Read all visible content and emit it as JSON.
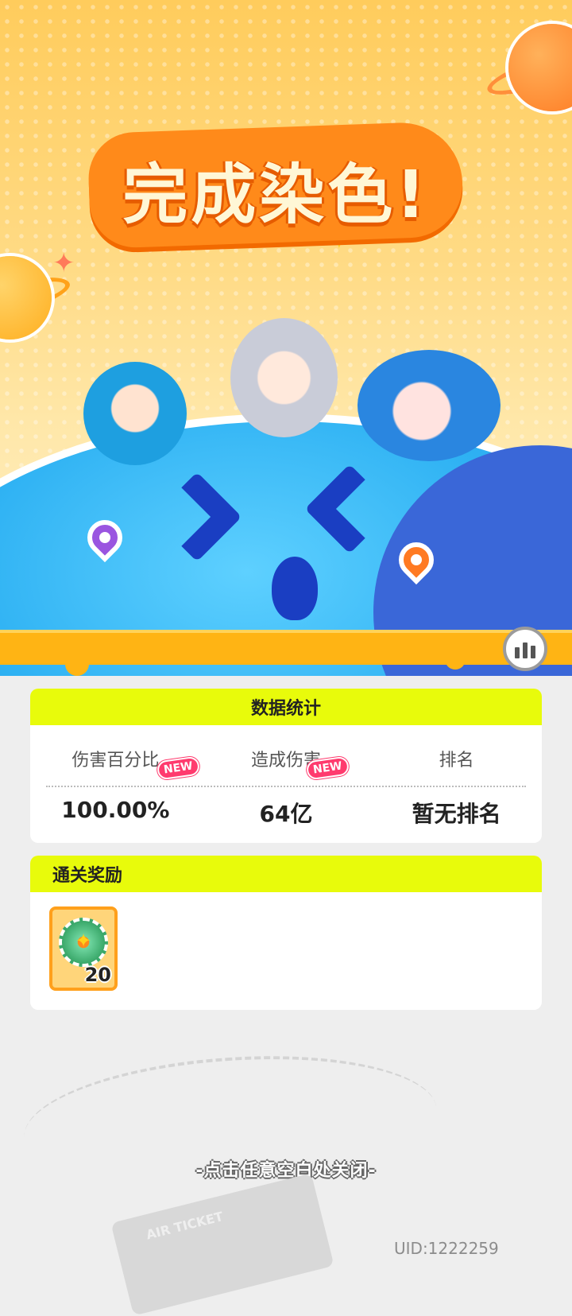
{
  "hero": {
    "title": "完成染色!",
    "characters": [
      "character-left-blue-hair",
      "character-center-silver-hair",
      "character-right-blue-bonnet"
    ]
  },
  "stats": {
    "header": "数据统计",
    "columns": [
      {
        "label": "伤害百分比",
        "value": "100.00%",
        "badge": "NEW"
      },
      {
        "label": "造成伤害",
        "value": "64亿",
        "badge": "NEW"
      },
      {
        "label": "排名",
        "value": "暂无排名"
      }
    ]
  },
  "rewards": {
    "header": "通关奖励",
    "items": [
      {
        "icon": "bottle-cap-icon",
        "count": "20"
      }
    ]
  },
  "footer": {
    "close_hint": "-点击任意空白处关闭-",
    "ticket_label": "AIR TICKET",
    "uid": "UID:1222259"
  },
  "colors": {
    "header_yellow": "#e8fb0b",
    "title_orange": "#ff8a1a",
    "globe_blue": "#2fb2f3",
    "badge_pink": "#ff3b6e"
  }
}
